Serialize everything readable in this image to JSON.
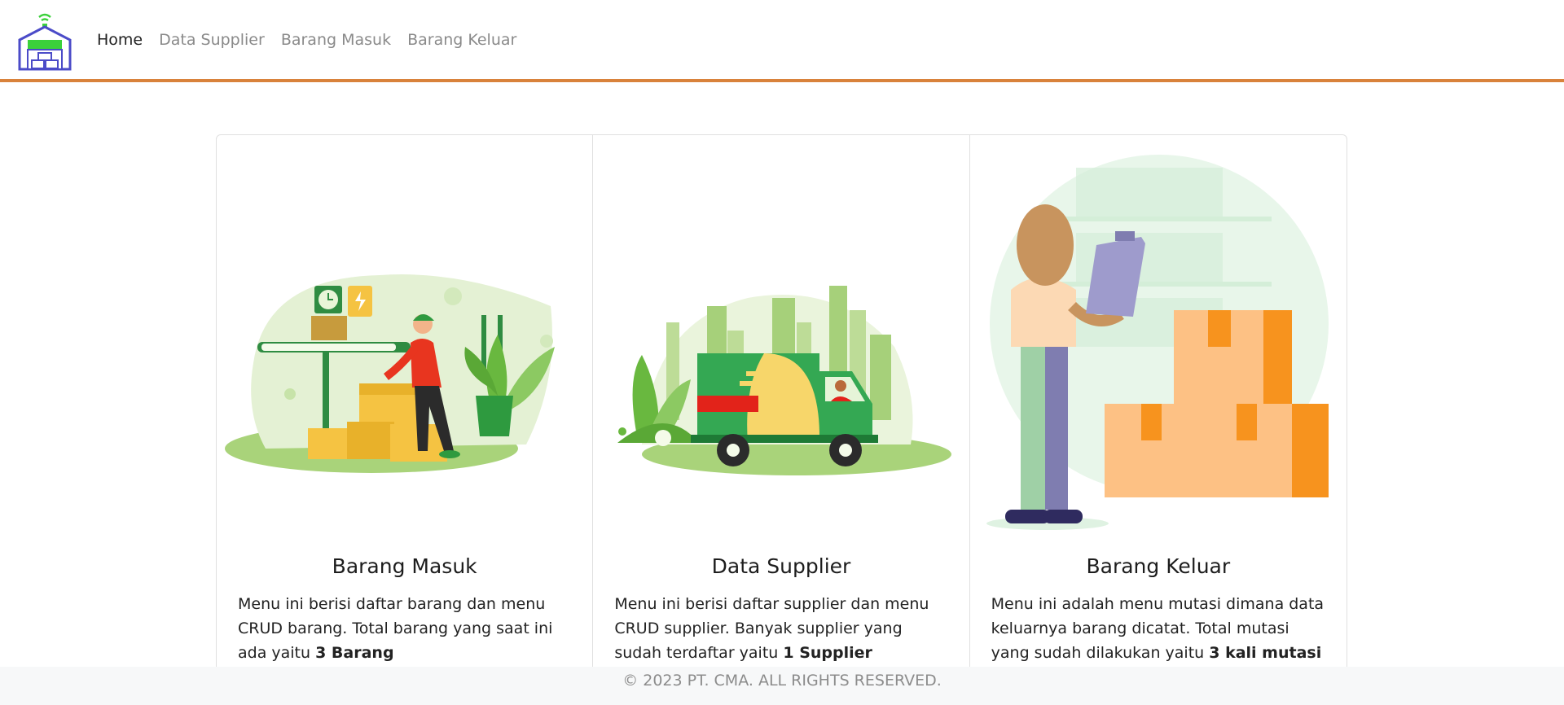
{
  "nav": {
    "brand": "warehouse-logo-icon",
    "links": [
      {
        "label": "Home",
        "active": true
      },
      {
        "label": "Data Supplier",
        "active": false
      },
      {
        "label": "Barang Masuk",
        "active": false
      },
      {
        "label": "Barang Keluar",
        "active": false
      }
    ]
  },
  "cards": [
    {
      "title": "Barang Masuk",
      "text": "Menu ini berisi daftar barang dan menu CRUD barang. Total barang yang saat ini ada yaitu ",
      "highlight": "3 Barang",
      "illustration": "worker-boxes-illustration"
    },
    {
      "title": "Data Supplier",
      "text": "Menu ini berisi daftar supplier dan menu CRUD supplier. Banyak supplier yang sudah terdaftar yaitu ",
      "highlight": "1 Supplier",
      "illustration": "delivery-truck-illustration"
    },
    {
      "title": "Barang Keluar",
      "text": "Menu ini adalah menu mutasi dimana data keluarnya barang dicatat. Total mutasi yang sudah dilakukan yaitu ",
      "highlight": "3 kali mutasi",
      "illustration": "clipboard-boxes-illustration"
    }
  ],
  "footer": {
    "text": "© 2023 PT. CMA. ALL RIGHTS RESERVED."
  },
  "colors": {
    "accent": "#d9823b",
    "green": "#34a853",
    "orange": "#f7931e"
  }
}
